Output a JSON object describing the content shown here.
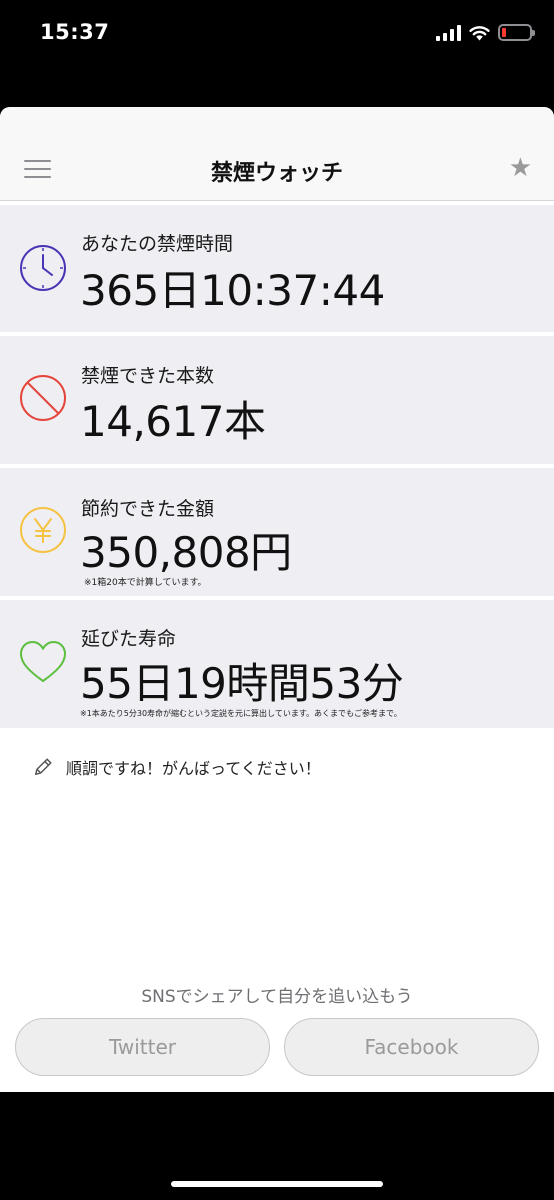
{
  "status_bar": {
    "time": "15:37"
  },
  "navbar": {
    "title": "禁煙ウォッチ",
    "menu_icon": "hamburger-menu-icon",
    "favorite_icon": "star-icon"
  },
  "stats": {
    "quit_time": {
      "label": "あなたの禁煙時間",
      "value": "365日10:37:44",
      "icon": "clock-icon",
      "icon_color": "#4b33b5"
    },
    "cigarettes_not_smoked": {
      "label": "禁煙できた本数",
      "value": "14,617本",
      "icon": "no-smoking-icon",
      "icon_color": "#e5453a"
    },
    "money_saved": {
      "label": "節約できた金額",
      "value": "350,808円",
      "note": "※1箱20本で計算しています。",
      "icon": "yen-icon",
      "icon_color": "#f5c242"
    },
    "life_extended": {
      "label": "延びた寿命",
      "value": "55日19時間53分",
      "note": "※1本あたり5分30寿命が縮むという定説を元に算出しています。あくまでもご参考まで。",
      "icon": "heart-icon",
      "icon_color": "#5cbf3f"
    }
  },
  "message": {
    "icon": "pencil-icon",
    "text": "順調ですね！がんばってください！"
  },
  "share": {
    "caption": "SNSでシェアして自分を追い込もう",
    "twitter_label": "Twitter",
    "facebook_label": "Facebook"
  }
}
